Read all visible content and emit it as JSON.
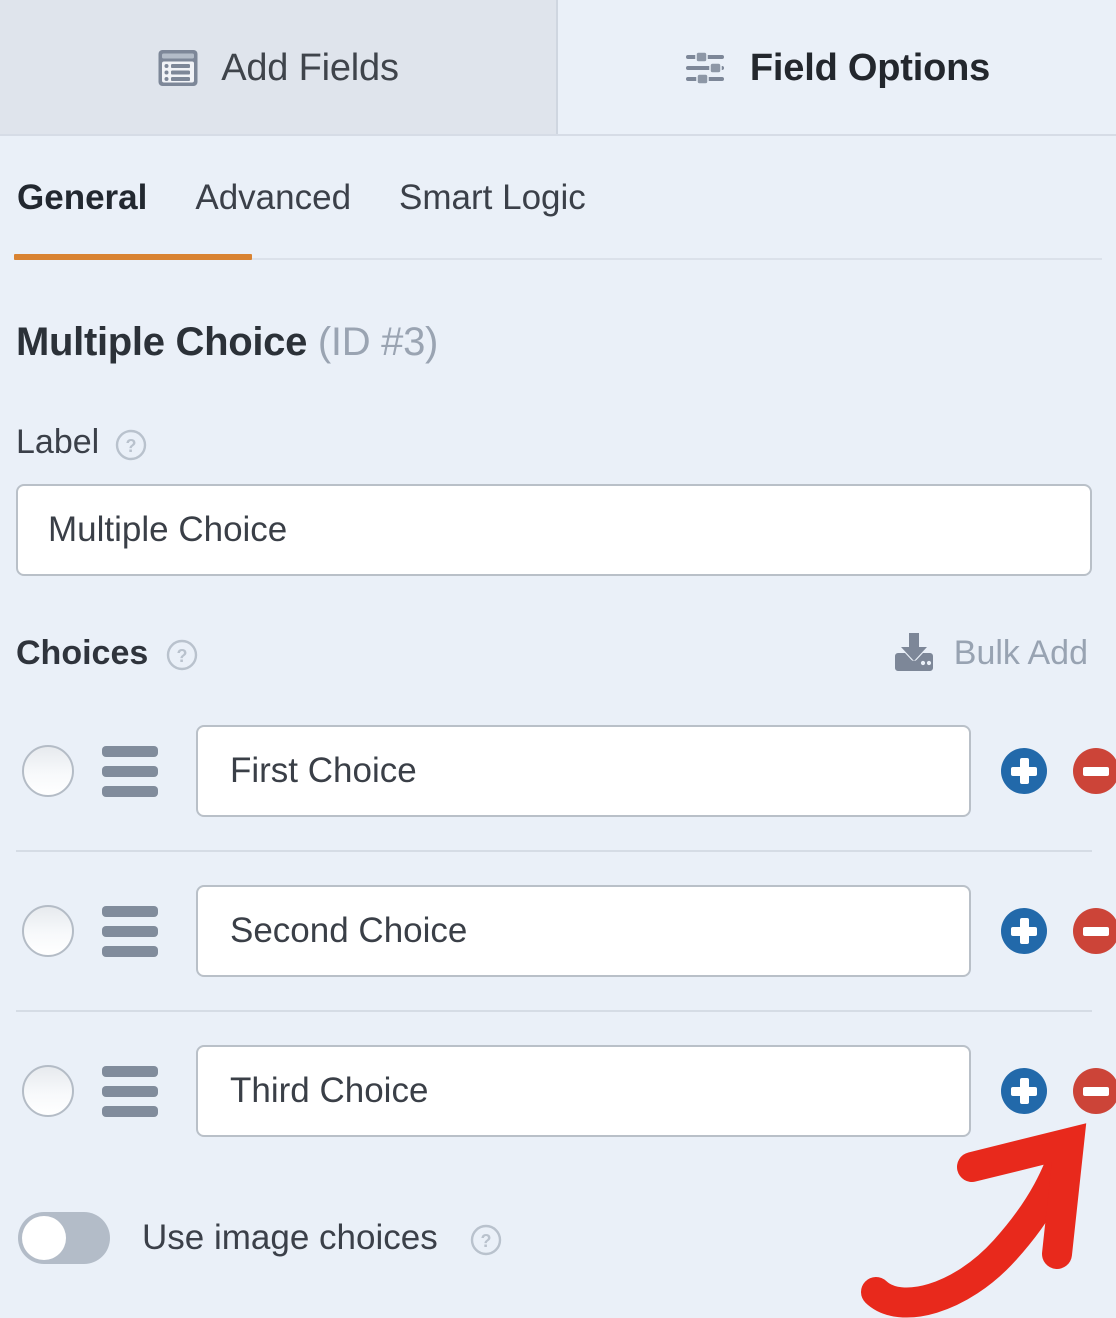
{
  "topbar": {
    "tabs": [
      {
        "label": "Add Fields",
        "icon": "form-list-icon",
        "active": false
      },
      {
        "label": "Field Options",
        "icon": "sliders-icon",
        "active": true
      }
    ]
  },
  "subtabs": {
    "items": [
      {
        "label": "General",
        "active": true
      },
      {
        "label": "Advanced",
        "active": false
      },
      {
        "label": "Smart Logic",
        "active": false
      }
    ],
    "active_underline_color": "#d98332"
  },
  "field": {
    "title": "Multiple Choice",
    "id_text": "(ID #3)",
    "label_section": {
      "label": "Label",
      "help_icon": "question-mark-icon",
      "input_value": "Multiple Choice"
    },
    "choices_section": {
      "label": "Choices",
      "help_icon": "question-mark-icon",
      "bulk_add_label": "Bulk Add",
      "bulk_add_icon": "import-download-icon",
      "rows": [
        {
          "value": "First Choice",
          "selected": false,
          "add_label": "+",
          "remove_label": "−"
        },
        {
          "value": "Second Choice",
          "selected": false,
          "add_label": "+",
          "remove_label": "−"
        },
        {
          "value": "Third Choice",
          "selected": false,
          "add_label": "+",
          "remove_label": "−"
        }
      ]
    },
    "image_choices": {
      "label": "Use image choices",
      "help_icon": "question-mark-icon",
      "enabled": false
    }
  },
  "annotation": {
    "type": "hand-drawn-arrow",
    "color": "#e8291c",
    "points_to": "remove-choice-button-row-3"
  },
  "colors": {
    "background": "#eaf0f8",
    "inactive_tab": "#dfe4ec",
    "accent_orange": "#d98332",
    "add_blue": "#2269aa",
    "remove_red": "#cc4438",
    "annotation_red": "#e8291c"
  }
}
